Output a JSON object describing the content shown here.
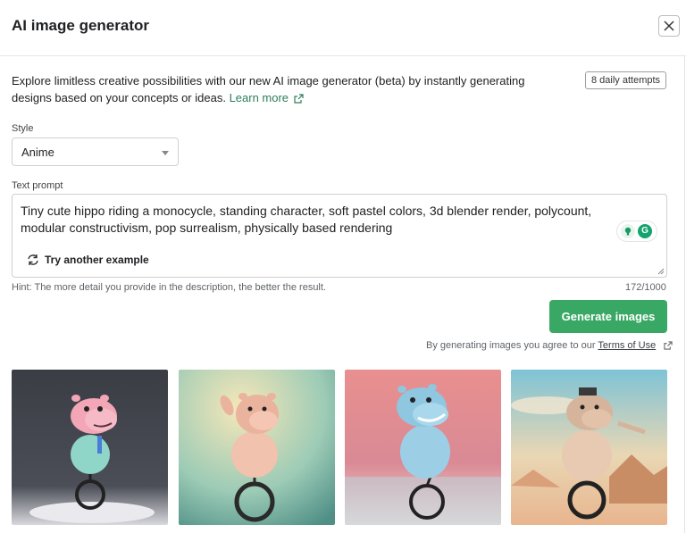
{
  "dialog": {
    "title": "AI image generator",
    "close_icon": "close-icon"
  },
  "intro": {
    "description": "Explore limitless creative possibilities with our new AI image generator (beta) by instantly generating designs based on your concepts or ideas.",
    "learn_more": "Learn more",
    "attempts_badge": "8 daily attempts"
  },
  "style": {
    "label": "Style",
    "selected": "Anime"
  },
  "prompt": {
    "label": "Text prompt",
    "value": "Tiny cute hippo riding a monocycle, standing character, soft pastel colors, 3d blender render, polycount, modular constructivism, pop surrealism, physically based rendering",
    "try_another": "Try another example",
    "hint": "Hint: The more detail you provide in the description, the better the result.",
    "char_count": "172/1000"
  },
  "actions": {
    "generate_label": "Generate images",
    "terms_prefix": "By generating images you agree to our",
    "terms_link": "Terms of Use"
  },
  "results": [
    {
      "name": "hippo-image-1"
    },
    {
      "name": "hippo-image-2"
    },
    {
      "name": "hippo-image-3"
    },
    {
      "name": "hippo-image-4"
    }
  ]
}
